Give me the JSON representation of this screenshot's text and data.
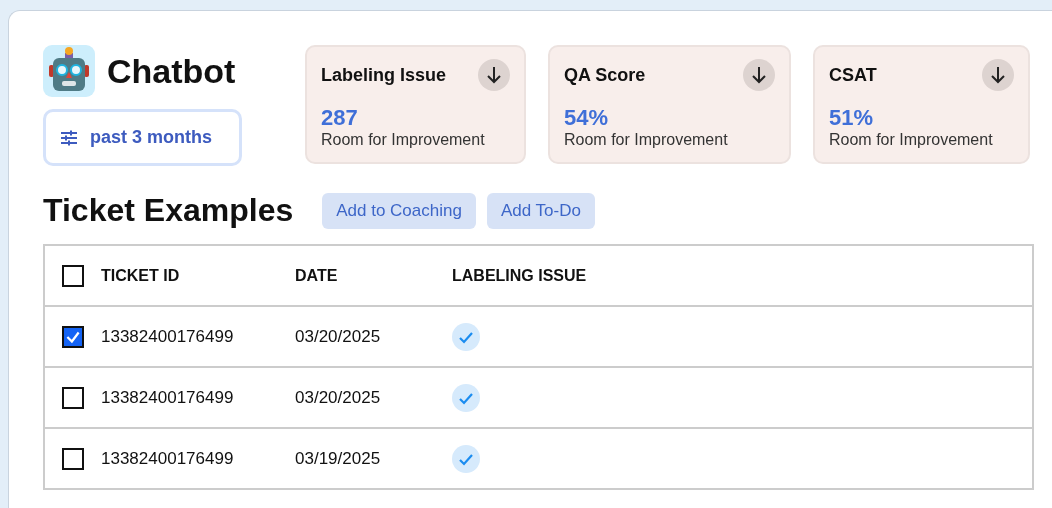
{
  "header": {
    "title": "Chatbot",
    "filter": "past 3 months"
  },
  "cards": [
    {
      "title": "Labeling Issue",
      "value": "287",
      "caption": "Room for Improvement"
    },
    {
      "title": "QA Score",
      "value": "54%",
      "caption": "Room for Improvement"
    },
    {
      "title": "CSAT",
      "value": "51%",
      "caption": "Room for Improvement"
    }
  ],
  "section": {
    "title": "Ticket Examples",
    "buttons": [
      "Add to Coaching",
      "Add To-Do"
    ]
  },
  "table": {
    "select_all": {
      "checked": false
    },
    "columns": [
      "TICKET ID",
      "DATE",
      "LABELING ISSUE"
    ],
    "rows": [
      {
        "checked": true,
        "ticket_id": "13382400176499",
        "date": "03/20/2025",
        "labeling_issue": true
      },
      {
        "checked": false,
        "ticket_id": "13382400176499",
        "date": "03/20/2025",
        "labeling_issue": true
      },
      {
        "checked": false,
        "ticket_id": "13382400176499",
        "date": "03/19/2025",
        "labeling_issue": true
      }
    ]
  }
}
